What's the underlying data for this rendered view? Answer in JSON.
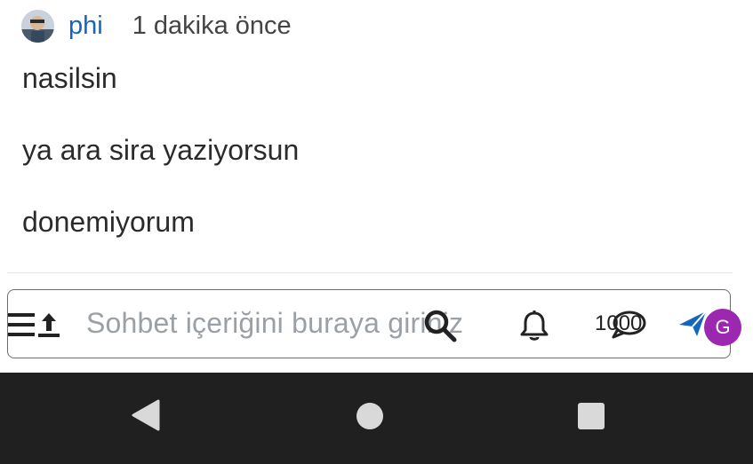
{
  "message": {
    "username": "phi",
    "timestamp": "1 dakika önce",
    "lines": [
      "nasilsin",
      "ya ara sira yaziyorsun",
      "donemiyorum"
    ]
  },
  "composer": {
    "placeholder": "Sohbet içeriğini buraya giriniz",
    "counter": "1000",
    "avatar_initial": "G"
  },
  "icons": {
    "menu": "menu-upload-icon",
    "search": "search-icon",
    "bell": "bell-icon",
    "chat": "chat-bubble-icon",
    "send": "send-icon"
  },
  "colors": {
    "username": "#1565c0",
    "send": "#1565c0",
    "badge": "#9c27b0",
    "navbar": "#202020"
  },
  "navbar": {
    "buttons": [
      "back",
      "home",
      "recents"
    ]
  }
}
